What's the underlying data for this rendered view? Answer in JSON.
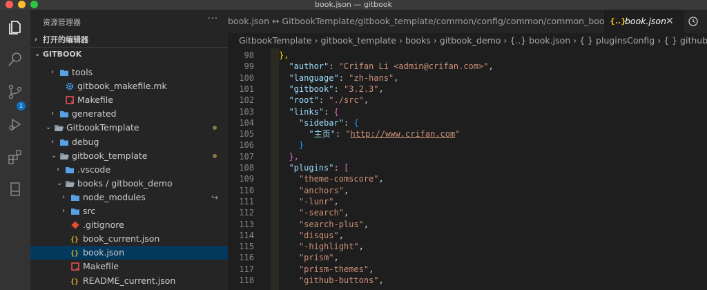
{
  "window": {
    "title": "book.json — gitbook"
  },
  "colors": {
    "accent": "#0e70c0",
    "selection": "#04395e",
    "json_icon": "#e6b422"
  },
  "sidebar": {
    "header": "资源管理器",
    "more": "···",
    "open_editors": "打开的编辑器",
    "root": "GITBOOK",
    "items": [
      {
        "label": "tools",
        "icon": "folder-icon",
        "indent": 2,
        "chevron": "›"
      },
      {
        "label": "gitbook_makefile.mk",
        "icon": "gear-icon",
        "indent": 3,
        "chevron": ""
      },
      {
        "label": "Makefile",
        "icon": "makefile-icon",
        "indent": 3,
        "chevron": ""
      },
      {
        "label": "generated",
        "icon": "folder-icon",
        "indent": 2,
        "chevron": "›"
      },
      {
        "label": "GitbookTemplate",
        "icon": "folder-open-icon",
        "indent": 1,
        "chevron": "⌄",
        "modified": true
      },
      {
        "label": "debug",
        "icon": "folder-icon",
        "indent": 2,
        "chevron": "›"
      },
      {
        "label": "gitbook_template",
        "icon": "folder-open-icon",
        "indent": 2,
        "chevron": "⌄",
        "modified": true
      },
      {
        "label": ".vscode",
        "icon": "folder-icon",
        "indent": 3,
        "chevron": "›"
      },
      {
        "label": "books / gitbook_demo",
        "icon": "folder-open-icon",
        "indent": 3,
        "chevron": "⌄"
      },
      {
        "label": "node_modules",
        "icon": "folder-icon",
        "indent": 4,
        "chevron": "›",
        "symlink": "↪"
      },
      {
        "label": "src",
        "icon": "folder-icon",
        "indent": 4,
        "chevron": "›"
      },
      {
        "label": ".gitignore",
        "icon": "git-icon",
        "indent": 4,
        "chevron": ""
      },
      {
        "label": "book_current.json",
        "icon": "json-icon",
        "indent": 4,
        "chevron": ""
      },
      {
        "label": "book.json",
        "icon": "json-icon",
        "indent": 4,
        "chevron": "",
        "selected": true
      },
      {
        "label": "Makefile",
        "icon": "makefile-icon",
        "indent": 4,
        "chevron": ""
      },
      {
        "label": "README_current.json",
        "icon": "json-icon",
        "indent": 4,
        "chevron": ""
      },
      {
        "label": "README.md",
        "icon": "info-icon",
        "indent": 4,
        "chevron": ""
      }
    ]
  },
  "tabs": {
    "inactive": "book.json ↔ GitbookTemplate/gitbook_template/common/config/common/common_book.json",
    "active_icon": "{..}",
    "active": "book.json",
    "close": "✕"
  },
  "breadcrumb": [
    "GitbookTemplate",
    "gitbook_template",
    "books",
    "gitbook_demo",
    "{..} book.json",
    "{ } pluginsConfig",
    "{ } github-buttons"
  ],
  "code": {
    "lines": [
      {
        "n": "98",
        "t": ""
      },
      {
        "n": "99",
        "t": ""
      },
      {
        "n": "100",
        "t": ""
      },
      {
        "n": "101",
        "t": ""
      },
      {
        "n": "102",
        "t": ""
      },
      {
        "n": "103",
        "t": ""
      },
      {
        "n": "104",
        "t": ""
      },
      {
        "n": "105",
        "t": ""
      },
      {
        "n": "106",
        "t": ""
      },
      {
        "n": "107",
        "t": ""
      },
      {
        "n": "108",
        "t": ""
      },
      {
        "n": "109",
        "t": ""
      },
      {
        "n": "110",
        "t": ""
      },
      {
        "n": "111",
        "t": ""
      },
      {
        "n": "112",
        "t": ""
      },
      {
        "n": "113",
        "t": ""
      },
      {
        "n": "114",
        "t": ""
      },
      {
        "n": "115",
        "t": ""
      },
      {
        "n": "116",
        "t": ""
      },
      {
        "n": "117",
        "t": ""
      },
      {
        "n": "118",
        "t": ""
      }
    ],
    "tokens": {
      "l98": "},",
      "l99k": "\"author\"",
      "l99v": "\"Crifan Li <admin@crifan.com>\"",
      "l100k": "\"language\"",
      "l100v": "\"zh-hans\"",
      "l101k": "\"gitbook\"",
      "l101v": "\"3.2.3\"",
      "l102k": "\"root\"",
      "l102v": "\"./src\"",
      "l103k": "\"links\"",
      "l104k": "\"sidebar\"",
      "l105k": "\"主页\"",
      "l105v": "\"http://www.crifan.com\"",
      "l109": "\"theme-comscore\"",
      "l110": "\"anchors\"",
      "l111": "\"-lunr\"",
      "l112": "\"-search\"",
      "l113": "\"search-plus\"",
      "l114": "\"disqus\"",
      "l115": "\"-highlight\"",
      "l116": "\"prism\"",
      "l117": "\"prism-themes\"",
      "l118": "\"github-buttons\"",
      "l108k": "\"plugins\""
    }
  }
}
